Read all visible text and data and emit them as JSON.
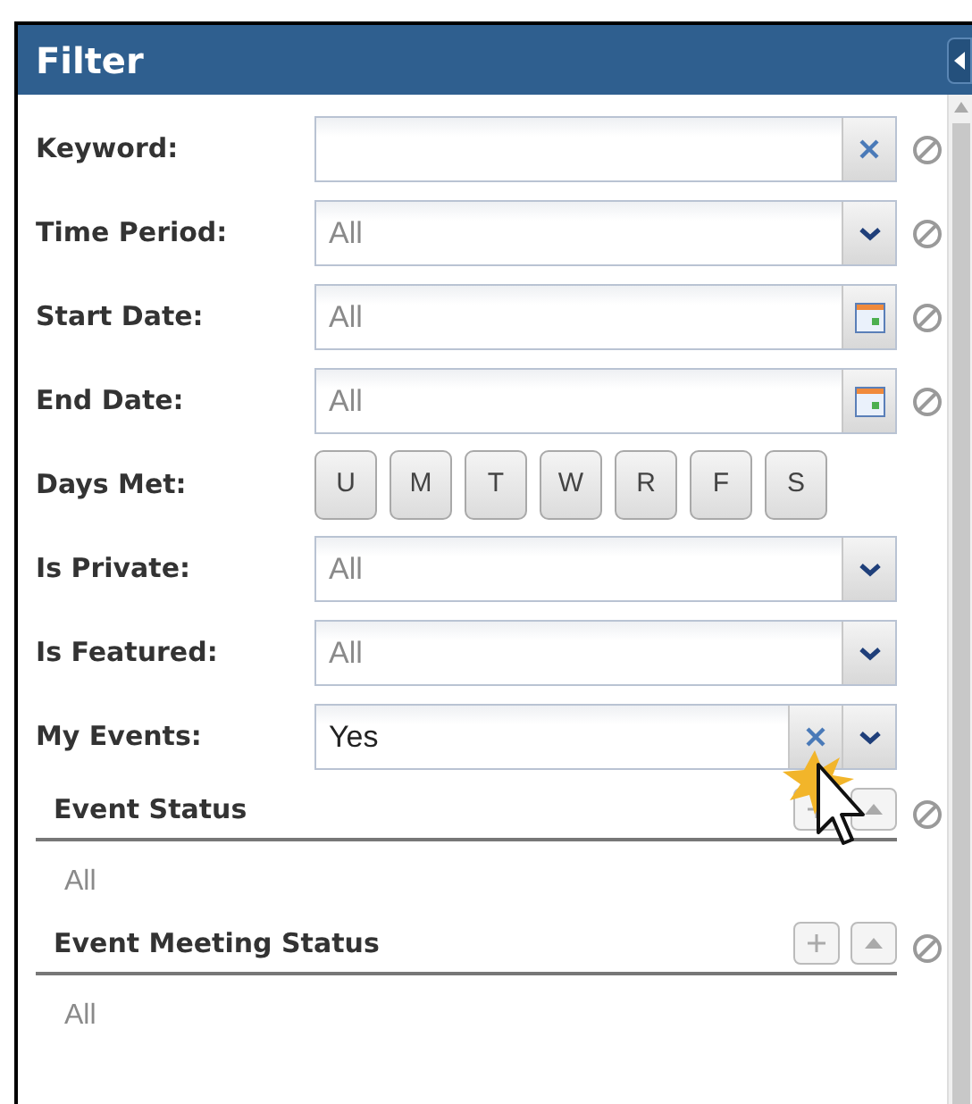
{
  "panel": {
    "title": "Filter"
  },
  "fields": [
    {
      "label": "Keyword:",
      "kind": "text",
      "reset": true
    },
    {
      "label": "Time Period:",
      "kind": "select",
      "placeholder": "All",
      "reset": true
    },
    {
      "label": "Start Date:",
      "kind": "date",
      "placeholder": "All",
      "reset": true
    },
    {
      "label": "End Date:",
      "kind": "date",
      "placeholder": "All",
      "reset": true
    },
    {
      "label": "Days Met:",
      "kind": "days",
      "days": [
        {
          "letter": "U",
          "selected": false
        },
        {
          "letter": "M",
          "selected": false
        },
        {
          "letter": "T",
          "selected": false
        },
        {
          "letter": "W",
          "selected": false
        },
        {
          "letter": "R",
          "selected": false
        },
        {
          "letter": "F",
          "selected": false
        },
        {
          "letter": "S",
          "selected": false
        }
      ],
      "reset": false
    },
    {
      "label": "Is Private:",
      "kind": "select",
      "placeholder": "All",
      "reset": false
    },
    {
      "label": "Is Featured:",
      "kind": "select",
      "placeholder": "All",
      "reset": false
    },
    {
      "label": "My Events:",
      "kind": "select_clear",
      "value": "Yes",
      "reset": false
    }
  ],
  "sections": [
    {
      "title": "Event Status",
      "summary": "All"
    },
    {
      "title": "Event Meeting Status",
      "summary": "All"
    }
  ]
}
